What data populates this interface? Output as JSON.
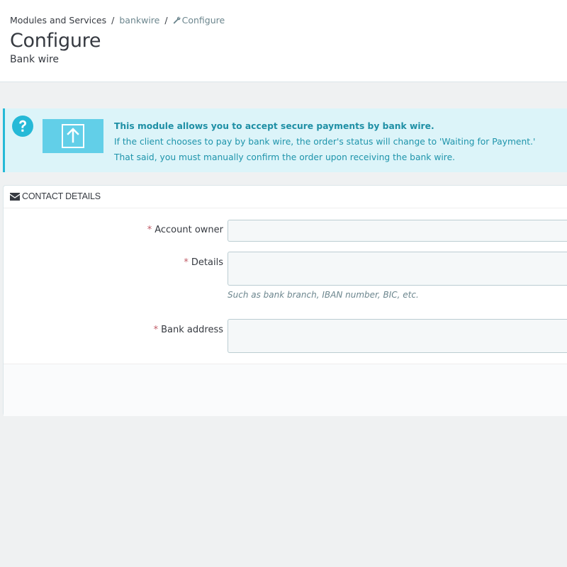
{
  "breadcrumb": {
    "items": [
      "Modules and Services",
      "bankwire",
      "Configure"
    ],
    "separator": "/"
  },
  "page": {
    "title": "Configure",
    "subtitle": "Bank wire"
  },
  "alert": {
    "icon": "question-circle-icon",
    "image": "upload-arrow-icon",
    "heading": "This module allows you to accept secure payments by bank wire.",
    "line1": "If the client chooses to pay by bank wire, the order's status will change to 'Waiting for Payment.'",
    "line2": "That said, you must manually confirm the order upon receiving the bank wire.",
    "accent": "#25b9d7"
  },
  "form": {
    "section_title": "CONTACT DETAILS",
    "section_icon": "envelope-icon",
    "required_marker": "*",
    "fields": [
      {
        "label": "Account owner",
        "value": "",
        "required": true
      },
      {
        "label": "Details",
        "value": "",
        "required": true,
        "help": "Such as bank branch, IBAN number, BIC, etc."
      },
      {
        "label": "Bank address",
        "value": "",
        "required": true
      }
    ]
  }
}
